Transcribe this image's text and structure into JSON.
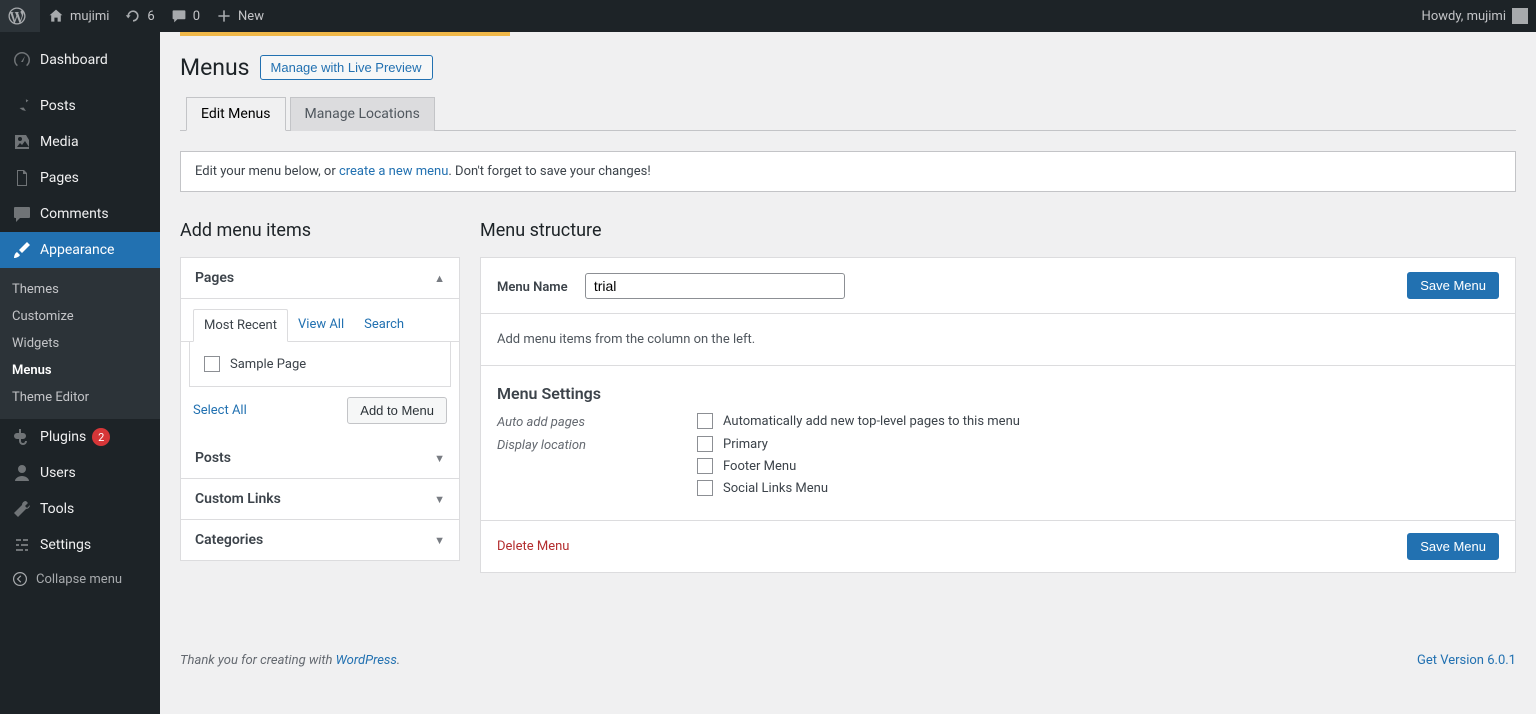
{
  "adminbar": {
    "site_name": "mujimi",
    "updates": "6",
    "comments": "0",
    "new_label": "New",
    "howdy": "Howdy, mujimi"
  },
  "sidebar": {
    "items": [
      {
        "label": "Dashboard"
      },
      {
        "label": "Posts"
      },
      {
        "label": "Media"
      },
      {
        "label": "Pages"
      },
      {
        "label": "Comments"
      },
      {
        "label": "Appearance"
      },
      {
        "label": "Plugins",
        "badge": "2"
      },
      {
        "label": "Users"
      },
      {
        "label": "Tools"
      },
      {
        "label": "Settings"
      }
    ],
    "submenu_appearance": [
      {
        "label": "Themes"
      },
      {
        "label": "Customize"
      },
      {
        "label": "Widgets"
      },
      {
        "label": "Menus"
      },
      {
        "label": "Theme Editor"
      }
    ],
    "collapse": "Collapse menu"
  },
  "page": {
    "title": "Menus",
    "live_preview": "Manage with Live Preview",
    "tabs": {
      "edit": "Edit Menus",
      "locations": "Manage Locations"
    },
    "notice_pre": "Edit your menu below, or ",
    "notice_link": "create a new menu",
    "notice_post": ". Don't forget to save your changes!"
  },
  "add_items": {
    "heading": "Add menu items",
    "pages_label": "Pages",
    "tabs": {
      "recent": "Most Recent",
      "view_all": "View All",
      "search": "Search"
    },
    "sample_page": "Sample Page",
    "select_all": "Select All",
    "add_btn": "Add to Menu",
    "posts_label": "Posts",
    "custom_links_label": "Custom Links",
    "categories_label": "Categories"
  },
  "structure": {
    "heading": "Menu structure",
    "menu_name_label": "Menu Name",
    "menu_name_value": "trial",
    "save_btn": "Save Menu",
    "placeholder_text": "Add menu items from the column on the left.",
    "settings_h": "Menu Settings",
    "auto_add_label": "Auto add pages",
    "auto_add_opt": "Automatically add new top-level pages to this menu",
    "display_loc_label": "Display location",
    "loc_primary": "Primary",
    "loc_footer": "Footer Menu",
    "loc_social": "Social Links Menu",
    "delete": "Delete Menu"
  },
  "footer": {
    "thanks_pre": "Thank you for creating with ",
    "wp": "WordPress",
    "version": "Get Version 6.0.1"
  }
}
